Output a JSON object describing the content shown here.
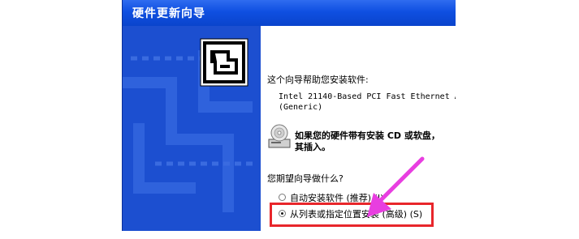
{
  "window": {
    "title": "硬件更新向导"
  },
  "content": {
    "intro": "这个向导帮助您安装软件:",
    "device_line1": "Intel 21140-Based PCI Fast Ethernet Ac",
    "device_line2": "(Generic)",
    "cd_hint_line1": "如果您的硬件带有安装 CD 或软盘，",
    "cd_hint_line2": "其插入。",
    "question": "您期望向导做什么?",
    "options": [
      {
        "label": "自动安装软件 (推荐) (I)",
        "checked": false
      },
      {
        "label": "从列表或指定位置安装 (高级) (S)",
        "checked": true
      }
    ]
  },
  "annotation": {
    "highlight_color": "#e8262b",
    "arrow_color": "#e83ee0"
  }
}
